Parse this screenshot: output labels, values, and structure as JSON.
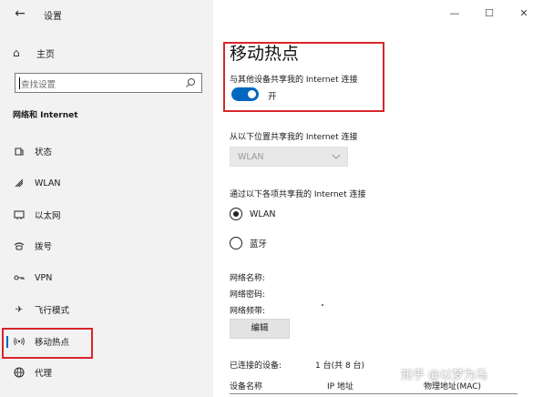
{
  "window": {
    "app_title": "设置",
    "controls": [
      "—",
      "☐",
      "✕"
    ]
  },
  "sidebar": {
    "home_label": "主页",
    "search_placeholder": "查找设置",
    "section_heading": "网络和 Internet",
    "items": [
      {
        "label": "状态",
        "icon": "status-icon"
      },
      {
        "label": "WLAN",
        "icon": "wifi-icon"
      },
      {
        "label": "以太网",
        "icon": "ethernet-icon"
      },
      {
        "label": "拨号",
        "icon": "dialup-icon"
      },
      {
        "label": "VPN",
        "icon": "vpn-icon"
      },
      {
        "label": "飞行模式",
        "icon": "airplane-icon"
      },
      {
        "label": "移动热点",
        "icon": "hotspot-icon",
        "active": true
      },
      {
        "label": "代理",
        "icon": "globe-icon"
      }
    ]
  },
  "main": {
    "title": "移动热点",
    "share_label": "与其他设备共享我的 Internet 连接",
    "toggle_state": "开",
    "toggle_on": true,
    "from_label": "从以下位置共享我的 Internet 连接",
    "from_value": "WLAN",
    "via_label": "通过以下各项共享我的 Internet 连接",
    "via_options": [
      {
        "label": "WLAN",
        "selected": true
      },
      {
        "label": "蓝牙",
        "selected": false
      }
    ],
    "network_name_label": "网络名称:",
    "network_password_label": "网络密码:",
    "network_band_label": "网络频带:",
    "edit_button": "编辑",
    "connected_devices_label": "已连接的设备:",
    "connected_devices_count": "1 台(共 8 台)",
    "table_headers": [
      "设备名称",
      "IP 地址",
      "物理地址(MAC)"
    ]
  },
  "watermark": "知乎 @以梦为马",
  "colors": {
    "accent": "#0067c0",
    "highlight_box": "#d7262a",
    "sidebar_bg": "#f2f2f2"
  }
}
